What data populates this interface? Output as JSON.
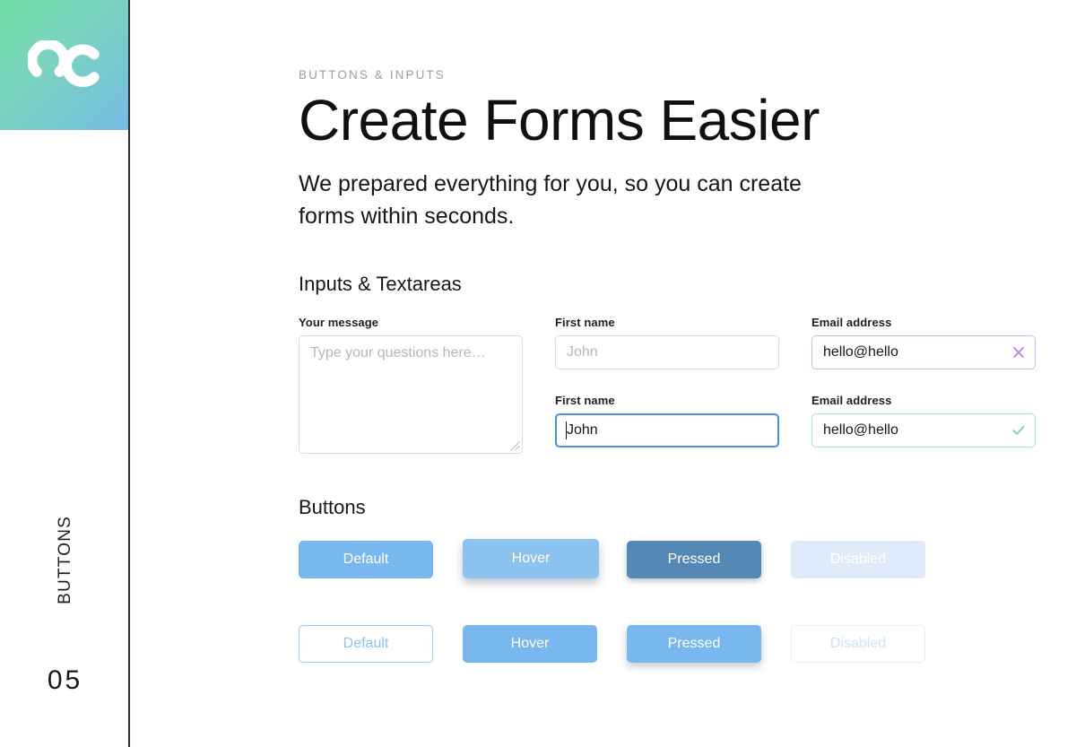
{
  "rail": {
    "logo_alt": "uc-logo",
    "vertical_label": "BUTTONS",
    "page_number": "05",
    "gradient_from": "#72dfa8",
    "gradient_to": "#74bbe6"
  },
  "header": {
    "eyebrow": "BUTTONS & INPUTS",
    "headline": "Create Forms Easier",
    "subhead": "We prepared everything for you, so you can create forms within seconds."
  },
  "sections": {
    "inputs_title": "Inputs & Textareas",
    "buttons_title": "Buttons"
  },
  "form": {
    "first_name_label": "First name",
    "first_name_placeholder": "John",
    "first_name_value": "John",
    "email_label": "Email address",
    "email_error_value": "hello@hello",
    "email_success_value": "hello@hello",
    "message_label": "Your message",
    "message_placeholder": "Type your questions here…",
    "error_icon": "close-x-icon",
    "success_icon": "check-icon",
    "error_color": "#b388e0",
    "success_color": "#7ad9a8",
    "focus_color": "#4d90d8"
  },
  "buttons": {
    "primary_row": [
      {
        "label": "Default",
        "state": "default"
      },
      {
        "label": "Hover",
        "state": "hover"
      },
      {
        "label": "Pressed",
        "state": "pressed"
      },
      {
        "label": "Disabled",
        "state": "disabled"
      }
    ],
    "secondary_row": [
      {
        "label": "Default",
        "state": "default"
      },
      {
        "label": "Hover",
        "state": "hover"
      },
      {
        "label": "Pressed",
        "state": "pressed"
      },
      {
        "label": "Disabled",
        "state": "disabled"
      }
    ],
    "accent_color": "#79b8ee"
  }
}
